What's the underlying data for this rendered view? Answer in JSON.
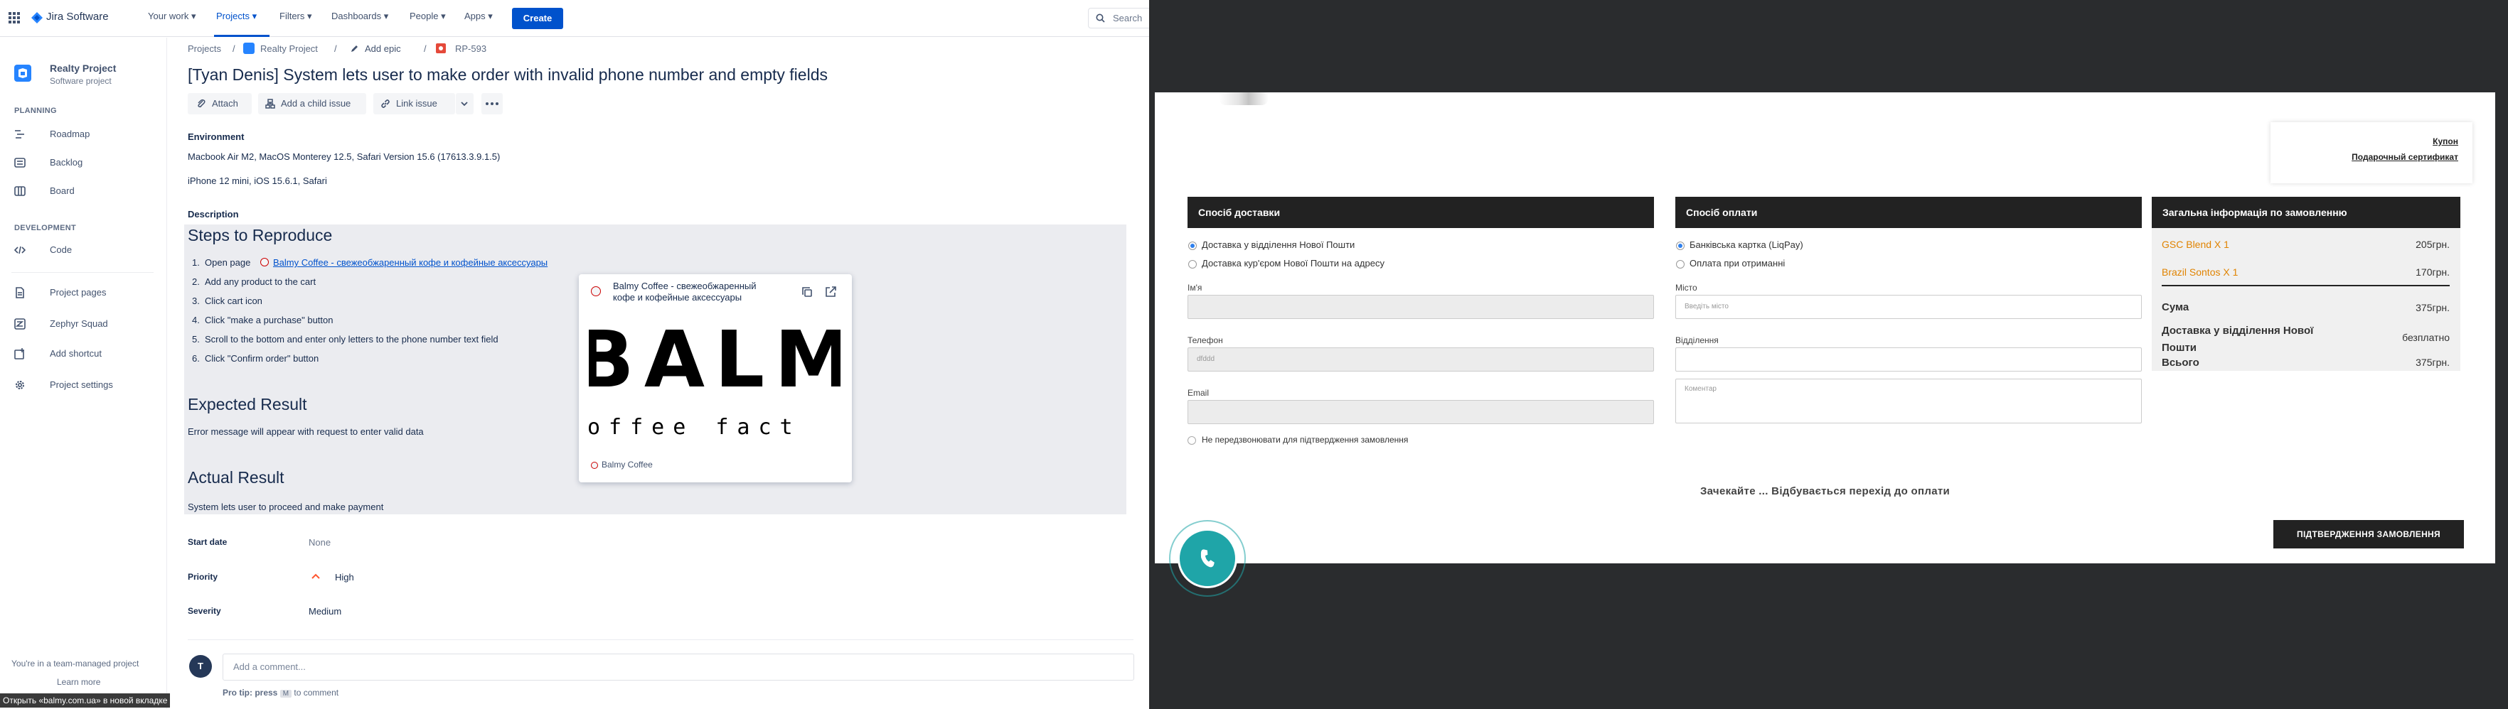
{
  "jira": {
    "brand": "Jira Software",
    "nav": [
      "Your work",
      "Projects",
      "Filters",
      "Dashboards",
      "People",
      "Apps"
    ],
    "create_label": "Create",
    "search_placeholder": "Search",
    "accent": "#0052cc",
    "sidebar": {
      "project_name": "Realty Project",
      "project_type": "Software project",
      "planning_header": "PLANNING",
      "planning_items": [
        "Roadmap",
        "Backlog",
        "Board"
      ],
      "development_header": "DEVELOPMENT",
      "development_items": [
        "Code"
      ],
      "other_items": [
        "Project pages",
        "Zephyr Squad",
        "Add shortcut",
        "Project settings"
      ],
      "footer_text": "You're in a team-managed project",
      "learn_more": "Learn more"
    },
    "breadcrumb": {
      "projects": "Projects",
      "project": "Realty Project",
      "add_epic": "Add epic",
      "issue_key": "RP-593"
    },
    "issue_title": "[Tyan Denis] System lets user to make order with invalid phone number and empty fields",
    "toolbar": {
      "attach": "Attach",
      "add_child": "Add a child issue",
      "link_issue": "Link issue"
    },
    "environment": {
      "label": "Environment",
      "line1": "Macbook Air M2, MacOS Monterey 12.5, Safari Version 15.6 (17613.3.9.1.5)",
      "line2": "iPhone 12 mini, iOS 15.6.1, Safari"
    },
    "description": {
      "label": "Description",
      "steps_heading": "Steps to Reproduce",
      "step1_prefix": "Open page",
      "step1_link": "Balmy Coffee - свежеобжаренный кофе и кофейные аксессуары",
      "step2": "Add any product to the cart",
      "step3": "Click cart icon",
      "step4": "Click \"make a purchase\" button",
      "step5": "Scroll to the bottom and enter only letters to the phone number text field",
      "step6": "Click \"Confirm order\" button",
      "expected_heading": "Expected Result",
      "expected_text": "Error message will appear with request to enter valid data",
      "actual_heading": "Actual Result",
      "actual_text": "System lets user to proceed and make payment"
    },
    "preview": {
      "title_line1": "Balmy Coffee - свежеобжаренный",
      "title_line2": "кофе и кофейные аксессуары",
      "banner_big": "BALM",
      "banner_small": "offee fact",
      "site": "Balmy Coffee"
    },
    "fields": {
      "start_date_label": "Start date",
      "start_date_value": "None",
      "priority_label": "Priority",
      "priority_value": "High",
      "severity_label": "Severity",
      "severity_value": "Medium"
    },
    "comment": {
      "avatar_initial": "T",
      "placeholder": "Add a comment...",
      "tip_prefix": "Pro tip: press",
      "tip_key": "M",
      "tip_suffix": "to comment"
    },
    "status_tooltip": "Открыть «balmy.com.ua» в новой вкладке"
  },
  "shop": {
    "coupon": "Купон",
    "gift_cert": "Подарочный сертификат",
    "delivery": {
      "heading": "Спосіб доставки",
      "option1": "Доставка у відділення Нової Пошти",
      "option2": "Доставка кур'єром Нової Пошти на адресу",
      "name_label": "Ім'я",
      "phone_label": "Телефон",
      "phone_value": "dfddd",
      "email_label": "Email",
      "no_call": "Не передзвонювати для підтвердження замовлення"
    },
    "payment": {
      "heading": "Спосіб оплати",
      "option1": "Банківська картка (LiqPay)",
      "option2": "Оплата при отриманні",
      "city_label": "Місто",
      "city_placeholder": "Введіть місто",
      "branch_label": "Відділення",
      "comment_placeholder": "Коментар"
    },
    "summary": {
      "heading": "Загальна інформація по замовленню",
      "item1_name": "GSC Blend X 1",
      "item1_price": "205грн.",
      "item2_name": "Brazil Sontos X 1",
      "item2_price": "170грн.",
      "sum_label": "Сума",
      "sum_value": "375грн.",
      "delivery_label": "Доставка у відділення Нової Пошти",
      "delivery_value": "безплатно",
      "total_label": "Всього",
      "total_value": "375грн."
    },
    "waiting": "Зачекайте ... Відбувається перехід до оплати",
    "confirm_button": "ПІДТВЕРДЖЕННЯ ЗАМОВЛЕННЯ",
    "accent_orange": "#e08300",
    "phone_widget_color": "#1fa5a8"
  }
}
